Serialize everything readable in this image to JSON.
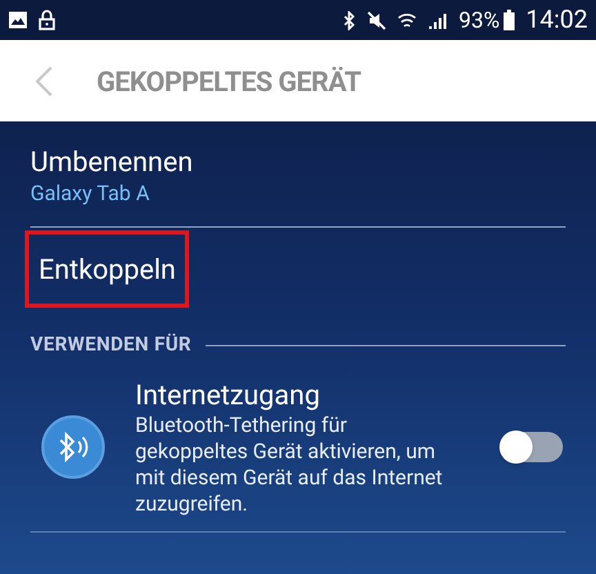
{
  "status_bar": {
    "battery": "93%",
    "time": "14:02"
  },
  "app_bar": {
    "title": "GEKOPPELTES GERÄT"
  },
  "items": [
    {
      "kind": "rename",
      "title": "Umbenennen",
      "subtitle": "Galaxy Tab A"
    },
    {
      "kind": "unpair",
      "title": "Entkoppeln",
      "highlighted": true
    }
  ],
  "section": {
    "header": "VERWENDEN FÜR",
    "profiles": [
      {
        "title": "Internetzugang",
        "description": "Bluetooth-Tethering für gekoppeltes Gerät aktivieren, um mit diesem Gerät auf das Internet zuzugreifen.",
        "on": false
      }
    ]
  }
}
